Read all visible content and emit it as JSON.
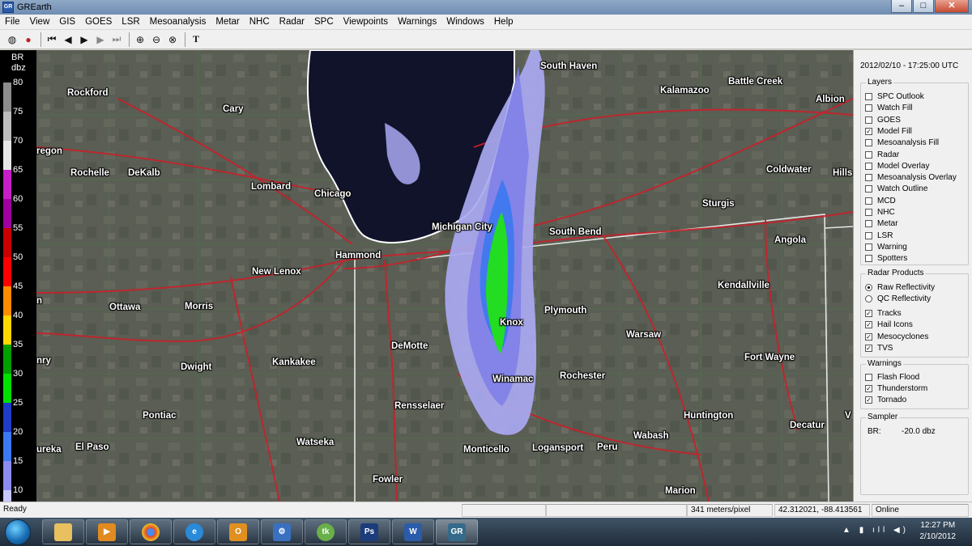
{
  "window": {
    "title": "GREarth",
    "icon_text": "GR"
  },
  "menu": [
    "File",
    "View",
    "GIS",
    "GOES",
    "LSR",
    "Mesoanalysis",
    "Metar",
    "NHC",
    "Radar",
    "SPC",
    "Viewpoints",
    "Warnings",
    "Windows",
    "Help"
  ],
  "colorbar": {
    "product": "BR",
    "unit": "dbz",
    "labels": [
      "80",
      "75",
      "70",
      "65",
      "60",
      "55",
      "50",
      "45",
      "40",
      "35",
      "30",
      "25",
      "20",
      "15",
      "10"
    ],
    "colors": [
      "#8c8c8c",
      "#bdbdbd",
      "#e6e6e6",
      "#c81ec8",
      "#a000a0",
      "#c80000",
      "#ff0000",
      "#ff8c00",
      "#ffd700",
      "#00a000",
      "#00e000",
      "#1e3cc8",
      "#3c78f0",
      "#8c8cf0",
      "#c8c8ff"
    ]
  },
  "map": {
    "cities": [
      "Rockford",
      "Cary",
      "South Haven",
      "Kalamazoo",
      "Battle Creek",
      "Albion",
      "regon",
      "Rochelle",
      "DeKalb",
      "Lombard",
      "Chicago",
      "Coldwater",
      "Hills",
      "Sturgis",
      "Michigan City",
      "South Bend",
      "Angola",
      "Hammond",
      "New Lenox",
      "Kendallville",
      "Ottawa",
      "Morris",
      "Plymouth",
      "Knox",
      "Warsaw",
      "DeMotte",
      "Fort Wayne",
      "nry",
      "Dwight",
      "Kankakee",
      "Rochester",
      "Winamac",
      "Rensselaer",
      "Pontiac",
      "Huntington",
      "Decatur",
      "V",
      "El Paso",
      "ureka",
      "Watseka",
      "Wabash",
      "Monticello",
      "Logansport",
      "Peru",
      "Fowler",
      "Marion",
      "n"
    ]
  },
  "panel": {
    "timestamp": "2012/02/10 - 17:25:00 UTC",
    "layers_title": "Layers",
    "layers": [
      {
        "label": "SPC Outlook",
        "checked": false
      },
      {
        "label": "Watch Fill",
        "checked": false
      },
      {
        "label": "GOES",
        "checked": false
      },
      {
        "label": "Model Fill",
        "checked": true
      },
      {
        "label": "Mesoanalysis Fill",
        "checked": false
      },
      {
        "label": "Radar",
        "checked": false
      },
      {
        "label": "Model Overlay",
        "checked": false
      },
      {
        "label": "Mesoanalysis Overlay",
        "checked": false
      },
      {
        "label": "Watch Outline",
        "checked": false
      },
      {
        "label": "MCD",
        "checked": false
      },
      {
        "label": "NHC",
        "checked": false
      },
      {
        "label": "Metar",
        "checked": false
      },
      {
        "label": "LSR",
        "checked": false
      },
      {
        "label": "Warning",
        "checked": false
      },
      {
        "label": "Spotters",
        "checked": false
      }
    ],
    "radar_title": "Radar Products",
    "radar_modes": [
      {
        "label": "Raw Reflectivity",
        "selected": true
      },
      {
        "label": "QC Reflectivity",
        "selected": false
      }
    ],
    "radar_overlays": [
      {
        "label": "Tracks",
        "checked": true
      },
      {
        "label": "Hail Icons",
        "checked": true
      },
      {
        "label": "Mesocyclones",
        "checked": true
      },
      {
        "label": "TVS",
        "checked": true
      }
    ],
    "warnings_title": "Warnings",
    "warnings": [
      {
        "label": "Flash Flood",
        "checked": false
      },
      {
        "label": "Thunderstorm",
        "checked": true
      },
      {
        "label": "Tornado",
        "checked": true
      }
    ],
    "sampler_title": "Sampler",
    "sampler_label": "BR:",
    "sampler_value": "-20.0 dbz"
  },
  "status": {
    "ready": "Ready",
    "scale": "341 meters/pixel",
    "coords": "42.312021, -88.413561",
    "connection": "Online"
  },
  "taskbar": {
    "apps": [
      "explorer-icon",
      "media-player-icon",
      "chrome-icon",
      "ie-icon",
      "outlook-icon",
      "settings-icon",
      "talk-icon",
      "photoshop-icon",
      "word-icon",
      "grearth-icon"
    ],
    "time": "12:27 PM",
    "date": "2/10/2012"
  }
}
